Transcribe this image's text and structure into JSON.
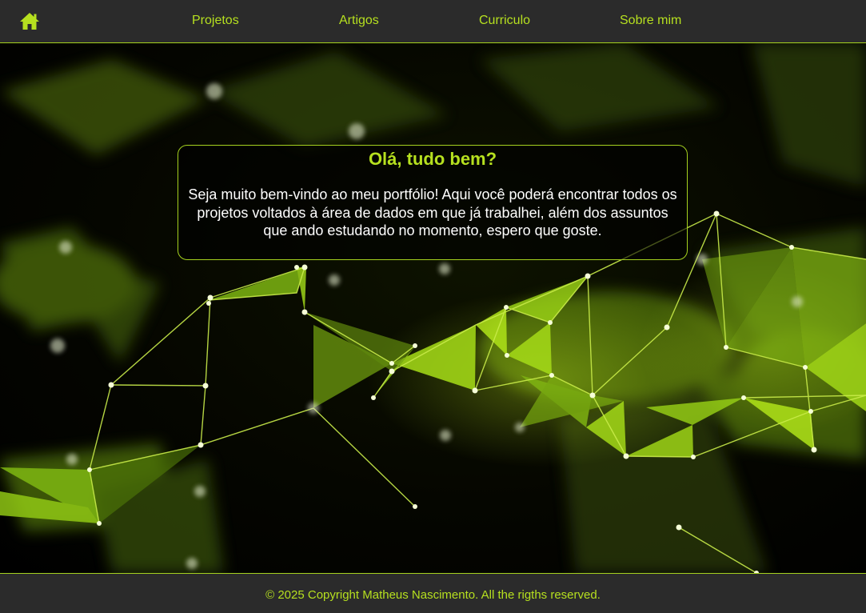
{
  "nav": {
    "home_icon": "home-icon",
    "links": [
      {
        "label": "Projetos"
      },
      {
        "label": "Artigos"
      },
      {
        "label": "Curriculo"
      },
      {
        "label": "Sobre mim"
      }
    ]
  },
  "hero": {
    "background": "green-polygon-network-image",
    "card": {
      "title": "Olá, tudo bem?",
      "text": "Seja muito bem-vindo ao meu portfólio! Aqui você poderá encontrar todos os projetos voltados à área de dados em que já trabalhei, além dos assuntos que ando estudando no momento, espero que goste."
    }
  },
  "footer": {
    "text": "© 2025 Copyright Matheus Nascimento. All the rigths reserved."
  },
  "colors": {
    "accent": "#b6e01f",
    "bar_background": "#2b2b2b",
    "border": "#a5d11e",
    "background": "#000000"
  }
}
